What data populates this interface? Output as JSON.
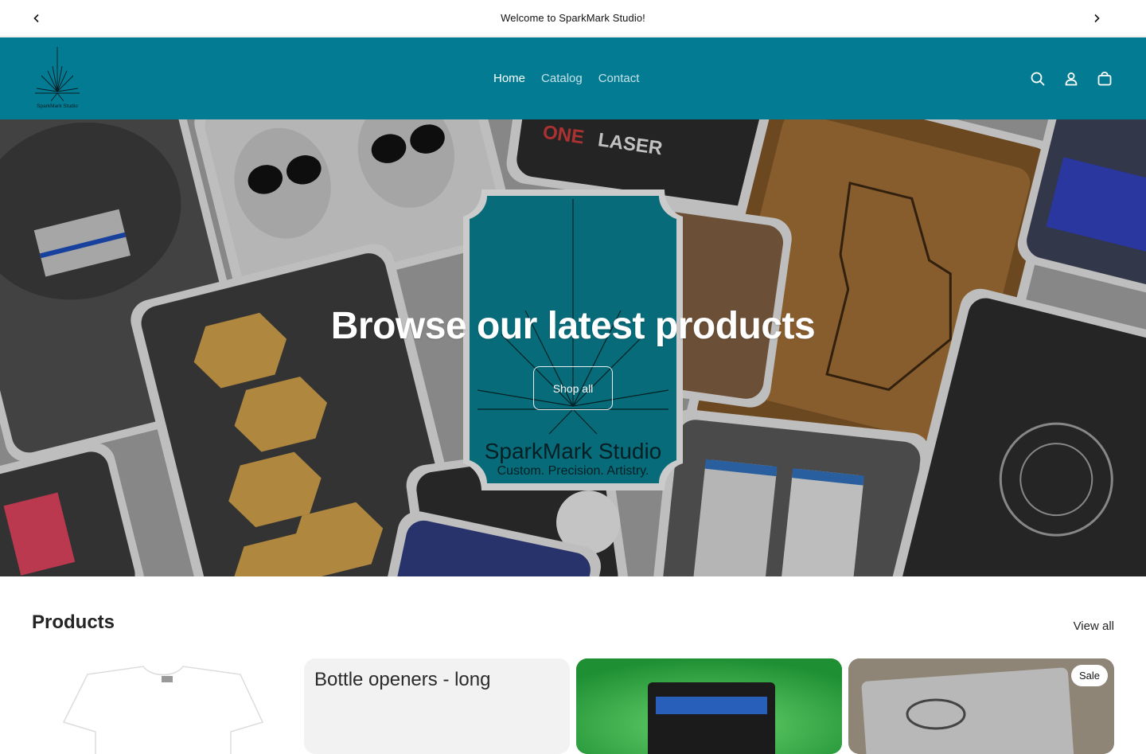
{
  "announcement": {
    "text": "Welcome to SparkMark Studio!"
  },
  "header": {
    "logo_text": "SparkMark Studio",
    "nav": [
      {
        "label": "Home",
        "active": true
      },
      {
        "label": "Catalog",
        "active": false
      },
      {
        "label": "Contact",
        "active": false
      }
    ],
    "icons": [
      "search-icon",
      "account-icon",
      "cart-icon"
    ],
    "bg_color": "#037c93"
  },
  "hero": {
    "title": "Browse our latest products",
    "button_label": "Shop all",
    "center_logo_line1": "SparkMark Studio",
    "center_logo_line2": "Custom. Precision. Artistry."
  },
  "products": {
    "title": "Products",
    "view_all_label": "View all",
    "cards": [
      {
        "title": "",
        "badge": ""
      },
      {
        "title": "Bottle openers - long",
        "badge": ""
      },
      {
        "title": "",
        "badge": ""
      },
      {
        "title": "",
        "badge": "Sale"
      }
    ]
  }
}
